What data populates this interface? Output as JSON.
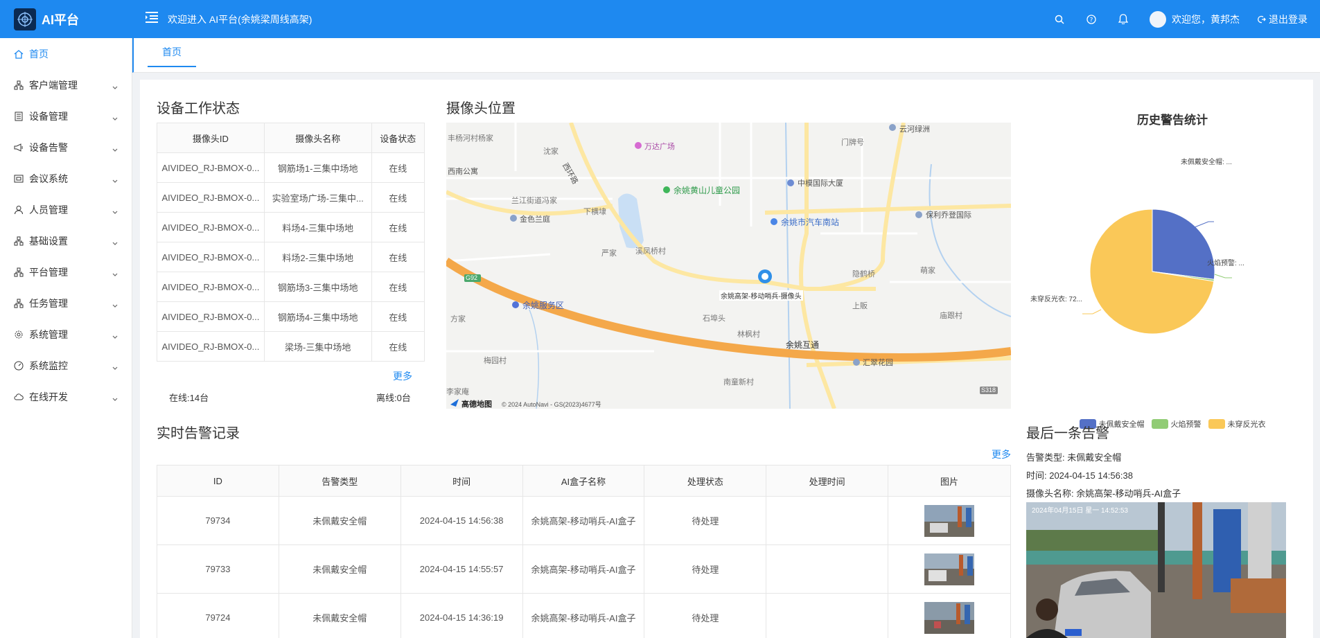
{
  "header": {
    "logo_text": "AI平台",
    "welcome": "欢迎进入 AI平台(余姚梁周线高架)",
    "user_greeting": "欢迎您，黄邦杰",
    "logout": "退出登录"
  },
  "sidebar": {
    "items": [
      {
        "label": "首页",
        "icon": "home-icon"
      },
      {
        "label": "客户端管理",
        "icon": "cluster-icon"
      },
      {
        "label": "设备管理",
        "icon": "device-icon"
      },
      {
        "label": "设备告警",
        "icon": "megaphone-icon"
      },
      {
        "label": "会议系统",
        "icon": "meeting-icon"
      },
      {
        "label": "人员管理",
        "icon": "user-icon"
      },
      {
        "label": "基础设置",
        "icon": "cluster-icon"
      },
      {
        "label": "平台管理",
        "icon": "cluster-icon"
      },
      {
        "label": "任务管理",
        "icon": "cluster-icon"
      },
      {
        "label": "系统管理",
        "icon": "gear-icon"
      },
      {
        "label": "系统监控",
        "icon": "gauge-icon"
      },
      {
        "label": "在线开发",
        "icon": "cloud-icon"
      }
    ]
  },
  "tabs": [
    {
      "label": "首页"
    }
  ],
  "device_status": {
    "title": "设备工作状态",
    "headers": [
      "摄像头ID",
      "摄像头名称",
      "设备状态"
    ],
    "rows": [
      [
        "AIVIDEO_RJ-BMOX-0...",
        "钢筋场1-三集中场地",
        "在线"
      ],
      [
        "AIVIDEO_RJ-BMOX-0...",
        "实验室场广场-三集中...",
        "在线"
      ],
      [
        "AIVIDEO_RJ-BMOX-0...",
        "料场4-三集中场地",
        "在线"
      ],
      [
        "AIVIDEO_RJ-BMOX-0...",
        "料场2-三集中场地",
        "在线"
      ],
      [
        "AIVIDEO_RJ-BMOX-0...",
        "钢筋场3-三集中场地",
        "在线"
      ],
      [
        "AIVIDEO_RJ-BMOX-0...",
        "钢筋场4-三集中场地",
        "在线"
      ],
      [
        "AIVIDEO_RJ-BMOX-0...",
        "梁场-三集中场地",
        "在线"
      ]
    ],
    "more": "更多",
    "online": "在线:14台",
    "offline": "离线:0台"
  },
  "camera_map": {
    "title": "摄像头位置",
    "marker_label": "余姚高架-移动哨兵-摄像头",
    "copyright": "© 2024 AutoNavi - GS(2023)4677号",
    "brand": "高德地图",
    "labels": [
      {
        "text": "丰杨河村杨家"
      },
      {
        "text": "沈家"
      },
      {
        "text": "西南公寓"
      },
      {
        "text": "万达广场"
      },
      {
        "text": "门牌号"
      },
      {
        "text": "云河绿洲"
      },
      {
        "text": "中模国际大厦"
      },
      {
        "text": "余姚黄山儿童公园"
      },
      {
        "text": "兰江街道冯家"
      },
      {
        "text": "下横埭"
      },
      {
        "text": "金色兰庭"
      },
      {
        "text": "余姚市汽车南站"
      },
      {
        "text": "保利乔登国际"
      },
      {
        "text": "严家"
      },
      {
        "text": "溪凤桥村"
      },
      {
        "text": "隐鹤桥"
      },
      {
        "text": "萌家"
      },
      {
        "text": "余姚服务区"
      },
      {
        "text": "方家"
      },
      {
        "text": "上販"
      },
      {
        "text": "石埠头"
      },
      {
        "text": "庙跟村"
      },
      {
        "text": "林枫村"
      },
      {
        "text": "余姚互通"
      },
      {
        "text": "梅园村"
      },
      {
        "text": "汇翠花园"
      },
      {
        "text": "南童新村"
      },
      {
        "text": "李家庵"
      },
      {
        "text": "西环路"
      },
      {
        "text": "G92"
      },
      {
        "text": "S318"
      }
    ]
  },
  "history_chart": {
    "title": "历史警告统计",
    "legend": [
      "未佩戴安全帽",
      "火焰预警",
      "未穿反光衣"
    ],
    "slice_labels": [
      "未佩戴安全帽: ...",
      "火焰预警: ...",
      "未穿反光衣: 72..."
    ]
  },
  "chart_data": {
    "type": "pie",
    "title": "历史警告统计",
    "categories": [
      "未佩戴安全帽",
      "火焰预警",
      "未穿反光衣"
    ],
    "values": [
      27,
      0.5,
      72.5
    ],
    "colors": [
      "#5470c6",
      "#91cc75",
      "#fac858"
    ],
    "legend_position": "bottom"
  },
  "realtime_alerts": {
    "title": "实时告警记录",
    "more": "更多",
    "headers": [
      "ID",
      "告警类型",
      "时间",
      "AI盒子名称",
      "处理状态",
      "处理时间",
      "图片"
    ],
    "rows": [
      {
        "id": "79734",
        "type": "未佩戴安全帽",
        "time": "2024-04-15 14:56:38",
        "box": "余姚高架-移动哨兵-AI盒子",
        "status": "待处理",
        "handled": ""
      },
      {
        "id": "79733",
        "type": "未佩戴安全帽",
        "time": "2024-04-15 14:55:57",
        "box": "余姚高架-移动哨兵-AI盒子",
        "status": "待处理",
        "handled": ""
      },
      {
        "id": "79724",
        "type": "未佩戴安全帽",
        "time": "2024-04-15 14:36:19",
        "box": "余姚高架-移动哨兵-AI盒子",
        "status": "待处理",
        "handled": ""
      }
    ]
  },
  "last_alert": {
    "title": "最后一条告警",
    "type": "告警类型: 未佩戴安全帽",
    "time": "时间: 2024-04-15 14:56:38",
    "camera": "摄像头名称: 余姚高架-移动哨兵-AI盒子",
    "overlay_time": "2024年04月15日 星一 14:52:53"
  }
}
